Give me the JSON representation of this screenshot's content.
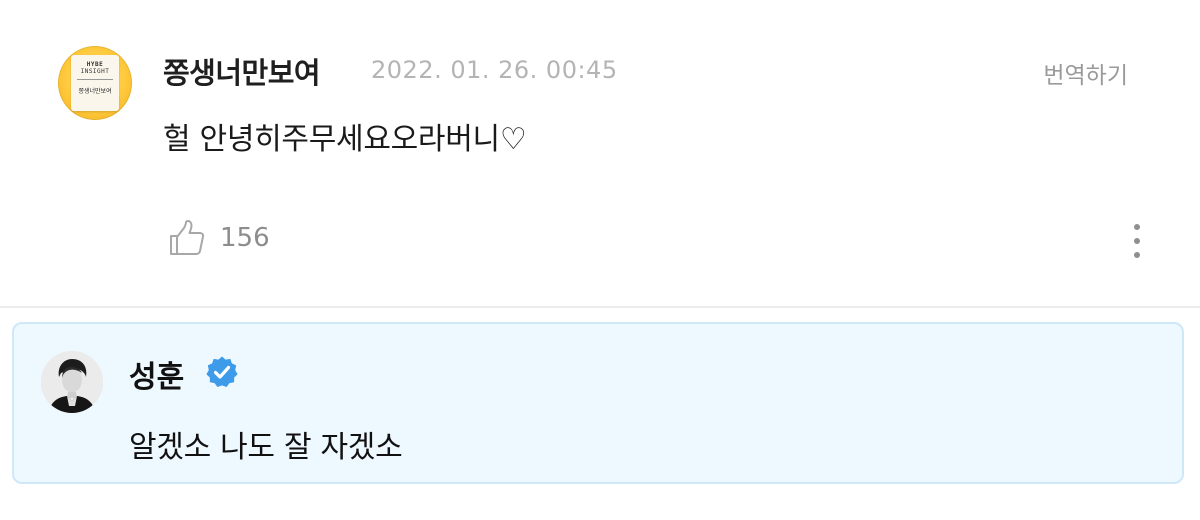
{
  "comment": {
    "author": "쫑생너만보여",
    "timestamp": "2022. 01. 26. 00:45",
    "translate_label": "번역하기",
    "text": "헐 안녕히주무세요오라버니♡",
    "like_count": "156",
    "avatar": {
      "card_line1": "HYBE",
      "card_line2": "INSIGHT",
      "card_name": "쫑생너만보여"
    }
  },
  "reply": {
    "author": "성훈",
    "verified": true,
    "text": "알겠소 나도 잘 자겠소"
  },
  "colors": {
    "reply_background": "#eef8ff",
    "reply_border": "#cfe8f7",
    "verified_badge": "#3d9be9",
    "secondary_text": "#b4b4b4"
  },
  "icons": {
    "like": "thumbs-up-icon",
    "more": "vertical-dots-icon",
    "verified": "verified-badge-icon"
  }
}
